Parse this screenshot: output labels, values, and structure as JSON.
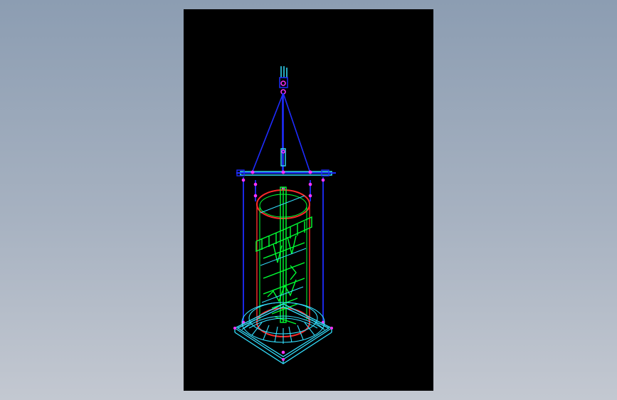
{
  "viewport": {
    "background": "#000000"
  },
  "colors": {
    "rigging": "#1e2cff",
    "spreader": "#33e0ff",
    "vessel_wire": "#00ff33",
    "ring": "#ff2a2a",
    "shackle": "#ff33ff",
    "base_frame": "#33e0ff"
  },
  "parts": [
    "lifting-hook",
    "sling-legs",
    "spreader-beam",
    "vertical-slings",
    "cylindrical-vessel",
    "internal-platform",
    "conical-skirt",
    "base-frame"
  ]
}
